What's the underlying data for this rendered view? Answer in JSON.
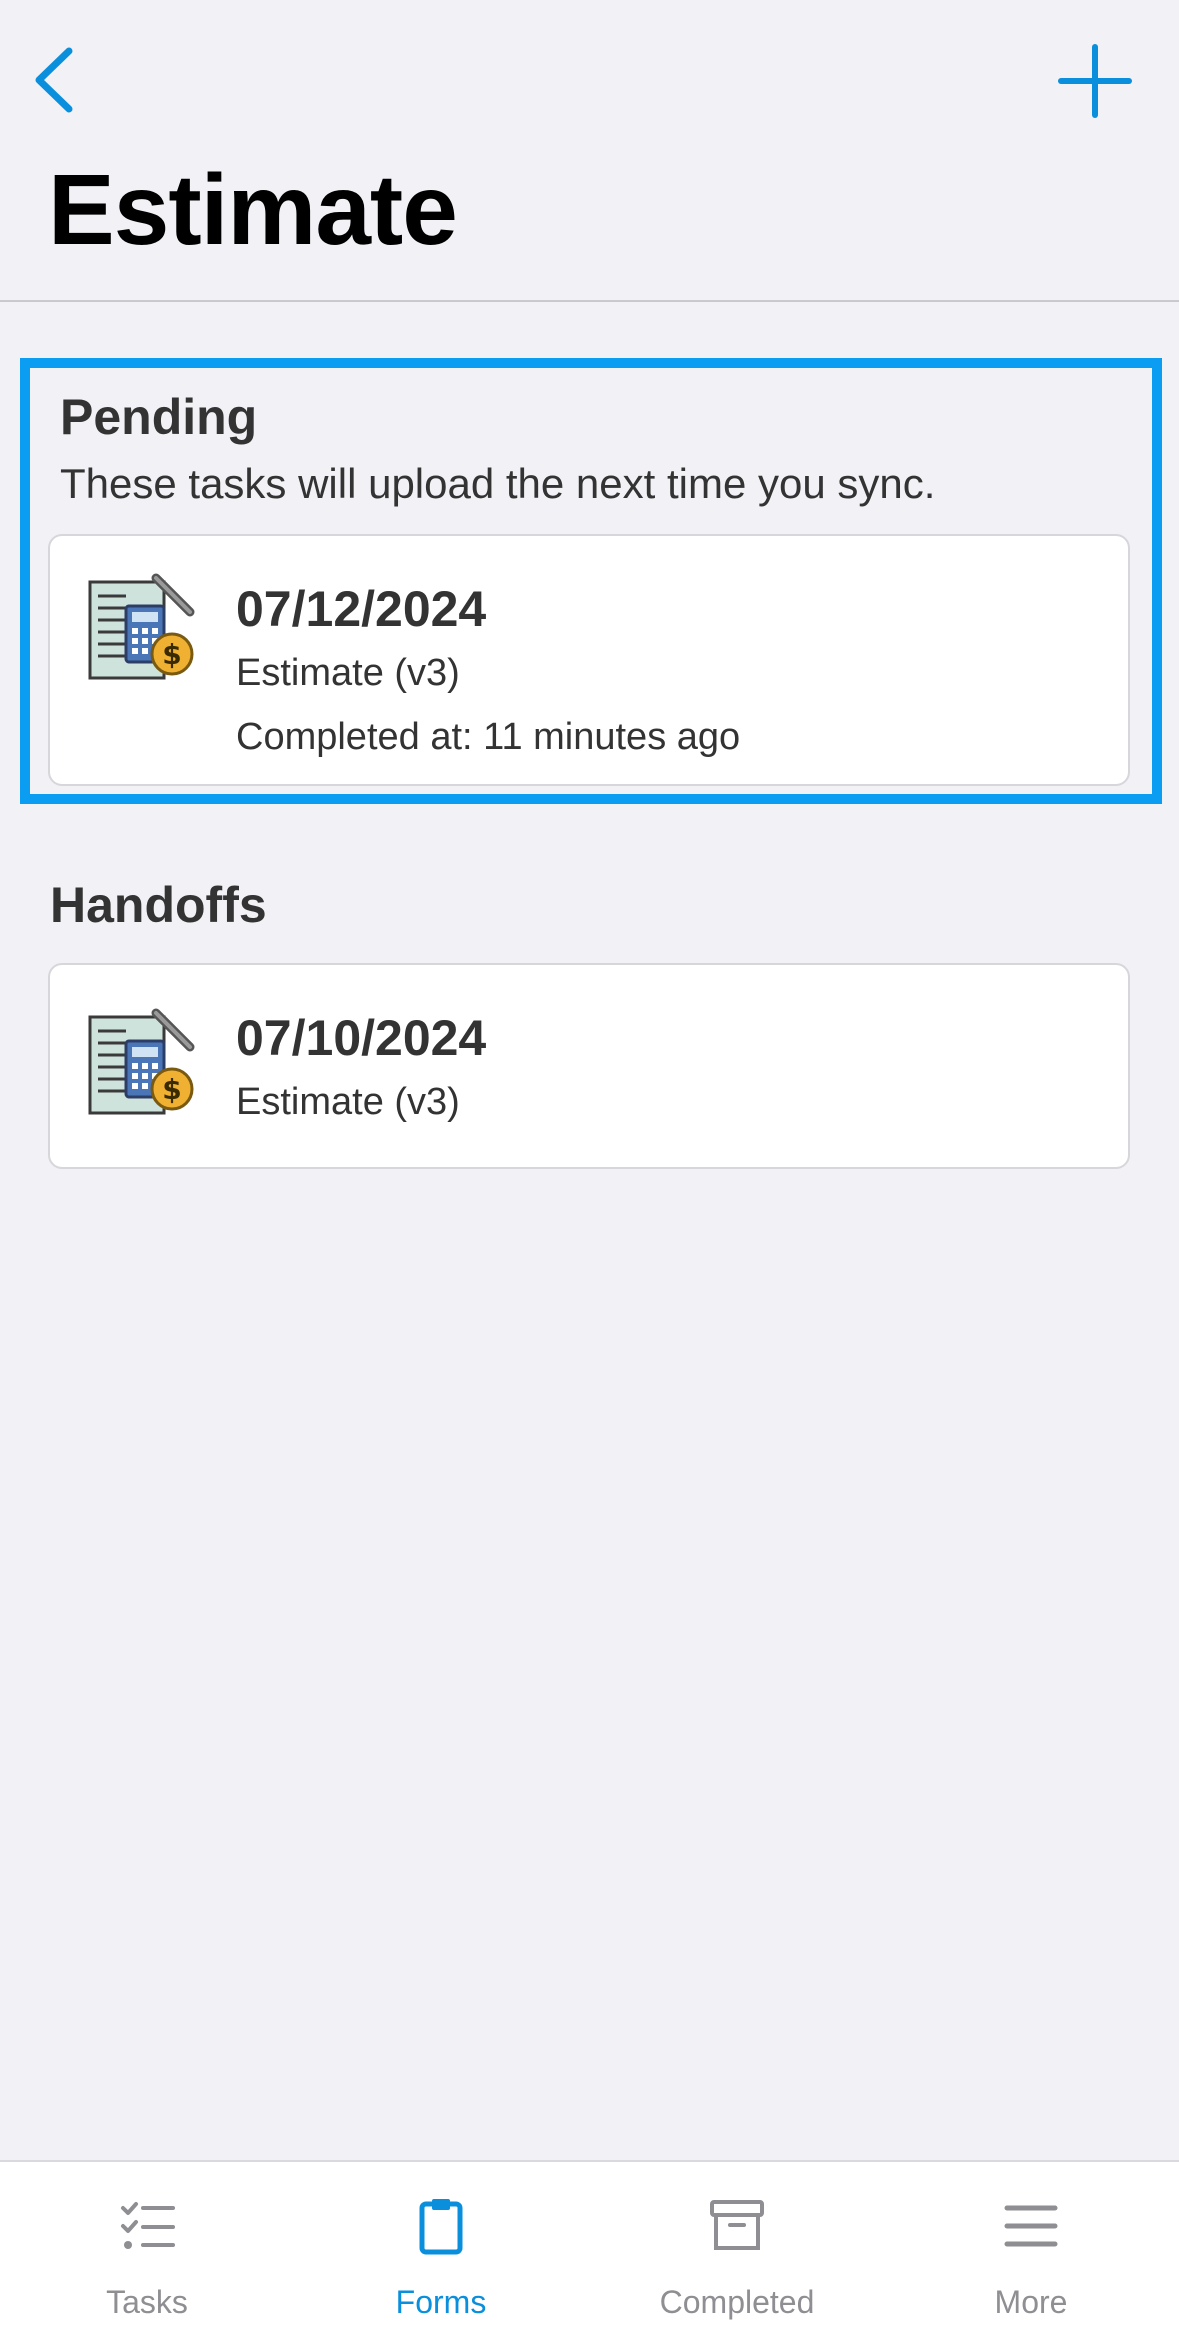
{
  "header": {
    "title": "Estimate",
    "back_icon": "chevron-left-icon",
    "add_icon": "plus-icon",
    "accent_color": "#0a8fdc"
  },
  "pending": {
    "title": "Pending",
    "subtitle": "These tasks will upload the next time you sync.",
    "highlight_color": "#0a9df2",
    "items": [
      {
        "date": "07/12/2024",
        "form": "Estimate (v3)",
        "completed": "Completed at: 11 minutes ago",
        "icon": "calculator-estimate-icon"
      }
    ]
  },
  "handoffs": {
    "title": "Handoffs",
    "items": [
      {
        "date": "07/10/2024",
        "form": "Estimate (v3)",
        "icon": "calculator-estimate-icon"
      }
    ]
  },
  "tabbar": {
    "tabs": [
      {
        "label": "Tasks",
        "icon": "checklist-icon",
        "active": false
      },
      {
        "label": "Forms",
        "icon": "clipboard-icon",
        "active": true
      },
      {
        "label": "Completed",
        "icon": "archive-box-icon",
        "active": false
      },
      {
        "label": "More",
        "icon": "menu-icon",
        "active": false
      }
    ],
    "active_color": "#0a8fdc",
    "inactive_color": "#8e8e93"
  }
}
